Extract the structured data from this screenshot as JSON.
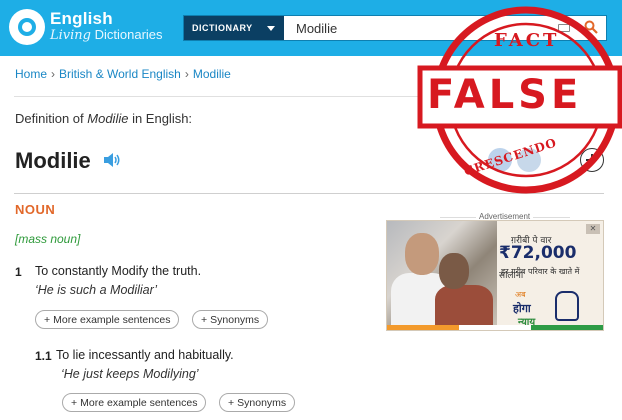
{
  "header": {
    "brand_line1": "English",
    "brand_line2_italic": "Living",
    "brand_line2_rest": " Dictionaries",
    "dictionary_button": "DICTIONARY",
    "search_value": "Modilie"
  },
  "breadcrumb": {
    "home": "Home",
    "section": "British & World English",
    "current": "Modilie"
  },
  "definition_of": {
    "prefix": "Definition of ",
    "word": "Modilie",
    "suffix": " in English:"
  },
  "headword": "Modilie",
  "part_of_speech": "NOUN",
  "grammar_note": "[mass noun]",
  "senses": [
    {
      "number": "1",
      "text": "To constantly Modify the truth.",
      "example": "‘He is such a Modiliar’",
      "more_examples": "More example sentences",
      "synonyms": "Synonyms"
    },
    {
      "number": "1.1",
      "text": "To lie incessantly and habitually.",
      "example": "‘He just keeps Modilying’",
      "more_examples": "More example sentences",
      "synonyms": "Synonyms"
    }
  ],
  "advertisement": {
    "label": "Advertisement",
    "line1": "ग़रीबी पे वार",
    "amount": "₹72,000",
    "amount_suffix": "सालाना",
    "line3": "हर ग़रीब परिवार के खाते में",
    "slogan_a": "अब",
    "slogan_b": "होगा",
    "slogan_c": "न्याय"
  },
  "stamp": {
    "top": "FACT",
    "middle": "FALSE",
    "bottom": "CRESCENDO",
    "color": "#d71920"
  },
  "colors": {
    "header_bg": "#1eaee6",
    "dictionary_button_bg": "#0b3f63",
    "link": "#1a87c5",
    "part_of_speech": "#e2682a",
    "grammar_note": "#2e9a3a"
  }
}
